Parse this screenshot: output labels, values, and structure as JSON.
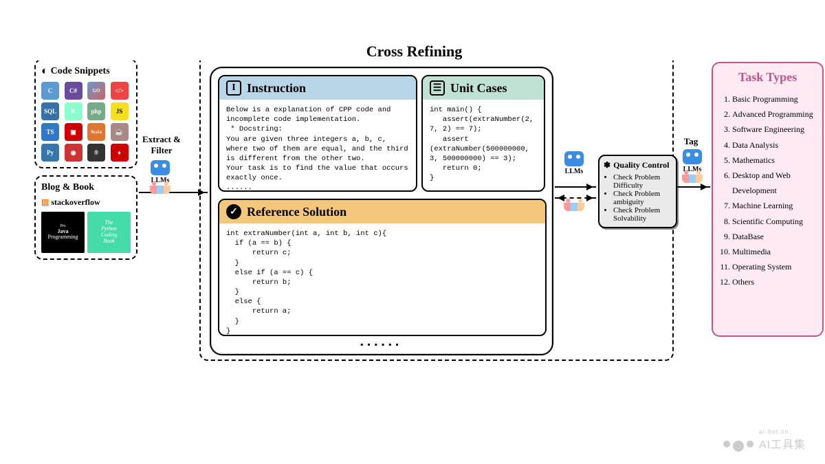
{
  "sources": {
    "code_title": "Code Snippets",
    "blog_title": "Blog & Book",
    "stack": "stackoverflow",
    "java_book": "Java",
    "java_book2": "Programming",
    "py_book1": "The",
    "py_book2": "Python",
    "py_book3": "Coding",
    "py_book4": "Book",
    "lang_icons": [
      "C",
      "C#",
      "GO",
      "</>",
      "SQL",
      "R",
      "php",
      "JS",
      "TS",
      "▣",
      "Scala",
      "☕",
      "Py",
      "◉",
      "®",
      "♦"
    ]
  },
  "flow": {
    "extract": "Extract & Filter",
    "llms": "LLMs",
    "tag": "Tag"
  },
  "main": {
    "title": "Cross Refining",
    "instruction": {
      "label": "Instruction",
      "body": "Below is a explanation of CPP code and incomplete code implementation.\n * Docstring:\nYou are given three integers a, b, c, where two of them are equal, and the third is different from the other two.\nYour task is to find the value that occurs exactly once.\n......"
    },
    "unit": {
      "label": "Unit Cases",
      "body": "int main() {\n   assert(extraNumber(2, 7, 2) == 7);\n   assert (extraNumber(500000000,\n3, 500000000) == 3);\n   return 0;\n}"
    },
    "ref": {
      "label": "Reference Solution",
      "body": "int extraNumber(int a, int b, int c){\n  if (a == b) {\n      return c;\n  }\n  else if (a == c) {\n      return b;\n  }\n  else {\n      return a;\n  }\n}"
    }
  },
  "qc": {
    "title": "Quality Control",
    "items": [
      "Check Problem Difficulty",
      "Check Problem ambiguity",
      "Check Problem Solvability"
    ]
  },
  "tt": {
    "title": "Task Types",
    "items": [
      "Basic Programming",
      "Advanced Programming",
      "Software Engineering",
      "Data Analysis",
      "Mathematics",
      "Desktop and Web Development",
      "Machine Learning",
      "Scientific Computing",
      "DataBase",
      "Multimedia",
      "Operating System",
      "Others"
    ]
  },
  "watermark": {
    "small": "ai-bot.cn",
    "big": "AI工具集"
  }
}
